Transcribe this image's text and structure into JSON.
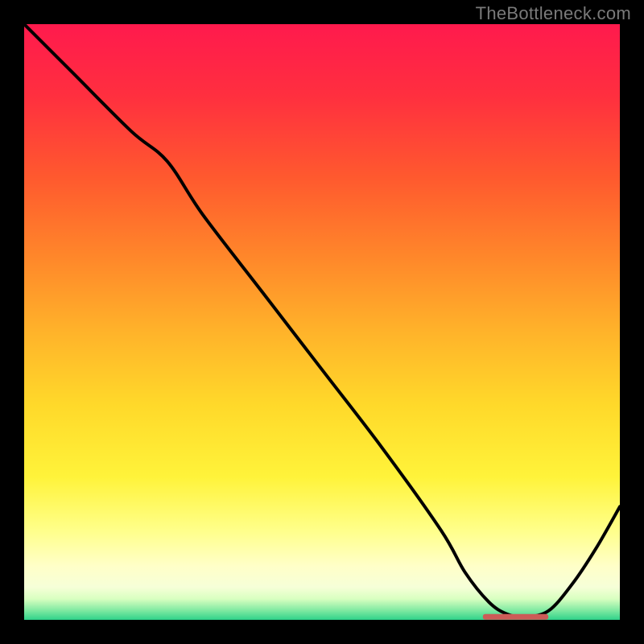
{
  "watermark": "TheBottleneck.com",
  "colors": {
    "frame_bg": "#000000",
    "watermark": "#7a7a7a",
    "curve": "#000000",
    "marker": "#cc5b57",
    "gradient_stops": [
      {
        "offset": 0.0,
        "color": "#ff1a4d"
      },
      {
        "offset": 0.12,
        "color": "#ff2f3f"
      },
      {
        "offset": 0.26,
        "color": "#ff5a2e"
      },
      {
        "offset": 0.4,
        "color": "#ff8a2a"
      },
      {
        "offset": 0.52,
        "color": "#ffb42a"
      },
      {
        "offset": 0.64,
        "color": "#ffd92a"
      },
      {
        "offset": 0.76,
        "color": "#fff33a"
      },
      {
        "offset": 0.85,
        "color": "#ffff8a"
      },
      {
        "offset": 0.91,
        "color": "#ffffc8"
      },
      {
        "offset": 0.945,
        "color": "#f6ffd8"
      },
      {
        "offset": 0.965,
        "color": "#d8ffc0"
      },
      {
        "offset": 0.985,
        "color": "#7be8a0"
      },
      {
        "offset": 1.0,
        "color": "#2fd28a"
      }
    ]
  },
  "chart_data": {
    "type": "line",
    "title": "",
    "xlabel": "",
    "ylabel": "",
    "xlim": [
      0,
      100
    ],
    "ylim": [
      0,
      100
    ],
    "grid": false,
    "legend": null,
    "series": [
      {
        "name": "curve",
        "x": [
          0,
          8,
          18,
          24,
          30,
          40,
          50,
          60,
          70,
          74,
          78,
          81,
          84,
          88,
          92,
          96,
          100
        ],
        "values": [
          100,
          92,
          82,
          77,
          68,
          55,
          42,
          29,
          15,
          8,
          3,
          1,
          0.5,
          1.5,
          6,
          12,
          19
        ]
      }
    ],
    "marker": {
      "x_start": 77,
      "x_end": 88,
      "y": 0.5
    },
    "background": "vertical-gradient"
  }
}
